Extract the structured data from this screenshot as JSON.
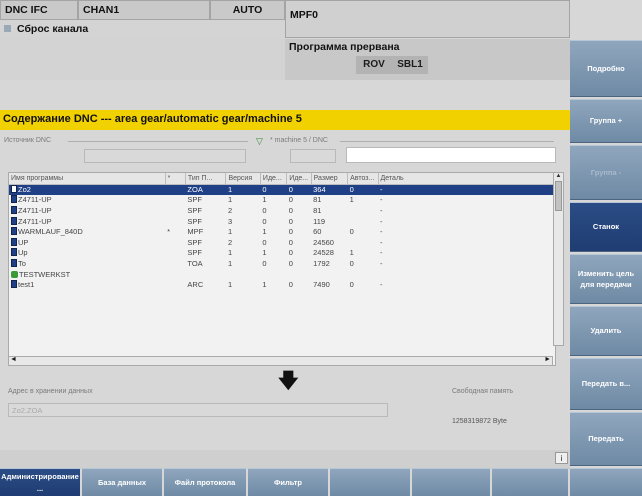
{
  "header": {
    "mode1": "DNC IFC",
    "mode2": "CHAN1",
    "mode3": "AUTO",
    "prog": "MPF0",
    "reset": "Сброс канала",
    "status": "Программа прервана",
    "flag1": "ROV",
    "flag2": "SBL1"
  },
  "title": "Содержание DNC --- area gear/automatic gear/machine 5",
  "source_label": "Источник DNC",
  "filter_label": "* machine 5 / DNC",
  "columns": [
    "Имя программы",
    "*",
    "Тип П...",
    "Версия",
    "Иде...",
    "Иде...",
    "Размер",
    "Автоз...",
    "Деталь"
  ],
  "rows": [
    {
      "name": "Zo2",
      "star": "",
      "type": "ZOA",
      "ver": "1",
      "id1": "0",
      "id2": "0",
      "size": "364",
      "auto": "0",
      "part": "-",
      "icon": "file"
    },
    {
      "name": "Z4711-UP",
      "star": "",
      "type": "SPF",
      "ver": "1",
      "id1": "1",
      "id2": "0",
      "size": "81",
      "auto": "1",
      "part": "-",
      "icon": "file"
    },
    {
      "name": "Z4711-UP",
      "star": "",
      "type": "SPF",
      "ver": "2",
      "id1": "0",
      "id2": "0",
      "size": "81",
      "auto": "",
      "part": "-",
      "icon": "file"
    },
    {
      "name": "Z4711-UP",
      "star": "",
      "type": "SPF",
      "ver": "3",
      "id1": "0",
      "id2": "0",
      "size": "119",
      "auto": "",
      "part": "-",
      "icon": "file"
    },
    {
      "name": "WARMLAUF_840D",
      "star": "*",
      "type": "MPF",
      "ver": "1",
      "id1": "1",
      "id2": "0",
      "size": "60",
      "auto": "0",
      "part": "-",
      "icon": "file"
    },
    {
      "name": "UP",
      "star": "",
      "type": "SPF",
      "ver": "2",
      "id1": "0",
      "id2": "0",
      "size": "24560",
      "auto": "",
      "part": "-",
      "icon": "file"
    },
    {
      "name": "Up",
      "star": "",
      "type": "SPF",
      "ver": "1",
      "id1": "1",
      "id2": "0",
      "size": "24528",
      "auto": "1",
      "part": "-",
      "icon": "file"
    },
    {
      "name": "To",
      "star": "",
      "type": "TOA",
      "ver": "1",
      "id1": "0",
      "id2": "0",
      "size": "1792",
      "auto": "0",
      "part": "-",
      "icon": "file"
    },
    {
      "name": "TESTWERKST",
      "star": "",
      "type": "",
      "ver": "",
      "id1": "",
      "id2": "",
      "size": "",
      "auto": "",
      "part": "",
      "icon": "dir"
    },
    {
      "name": "test1",
      "star": "",
      "type": "ARC",
      "ver": "1",
      "id1": "1",
      "id2": "0",
      "size": "7490",
      "auto": "0",
      "part": "-",
      "icon": "file"
    }
  ],
  "storage_label": "Адрес в хранении данных",
  "storage_value": "Zo2.ZOA",
  "free_label": "Свободная память",
  "free_value": "1258319872 Byte",
  "info_label": "i",
  "softkeys": [
    "Подробно",
    "Группа +",
    "Группа -",
    "Станок",
    "Изменить цель для передачи",
    "Удалить",
    "Передать в...",
    "Передать"
  ],
  "hkeys": [
    "Администрирование ...",
    "База данных",
    "Файл протокола",
    "Фильтр"
  ]
}
